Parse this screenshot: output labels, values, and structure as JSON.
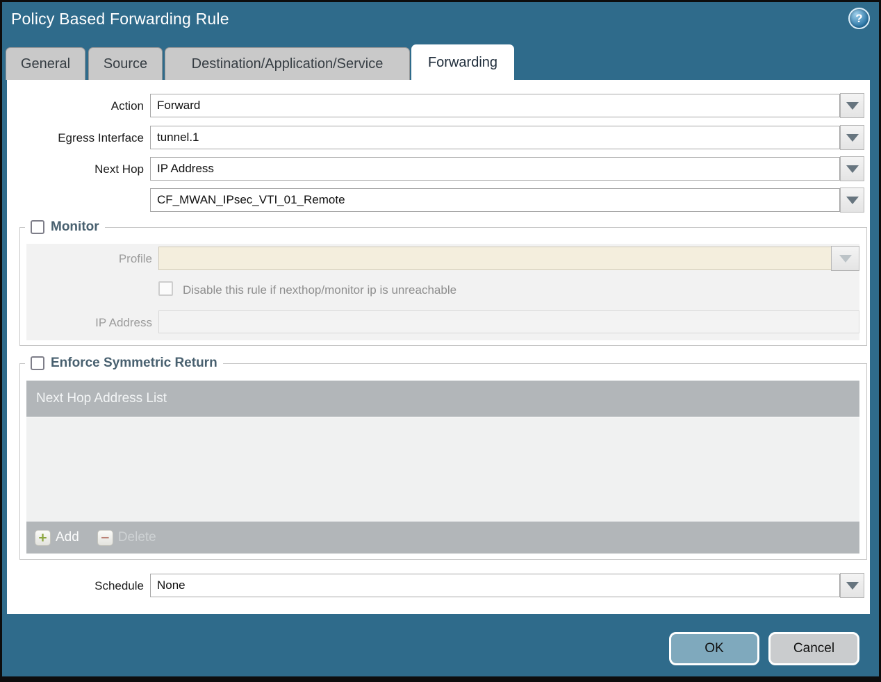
{
  "window": {
    "title": "Policy Based Forwarding Rule"
  },
  "help": {
    "glyph": "?"
  },
  "tabs": [
    {
      "label": "General",
      "active": false
    },
    {
      "label": "Source",
      "active": false
    },
    {
      "label": "Destination/Application/Service",
      "active": false
    },
    {
      "label": "Forwarding",
      "active": true
    }
  ],
  "form": {
    "action": {
      "label": "Action",
      "value": "Forward"
    },
    "egress_interface": {
      "label": "Egress Interface",
      "value": "tunnel.1"
    },
    "next_hop": {
      "label": "Next Hop",
      "value": "IP Address"
    },
    "next_hop_address": {
      "value": "CF_MWAN_IPsec_VTI_01_Remote"
    },
    "schedule": {
      "label": "Schedule",
      "value": "None"
    }
  },
  "monitor": {
    "label": "Monitor",
    "checked": false,
    "profile": {
      "label": "Profile",
      "value": ""
    },
    "disable_rule": {
      "label": "Disable this rule if nexthop/monitor ip is unreachable",
      "checked": false
    },
    "ip_address": {
      "label": "IP Address",
      "value": ""
    }
  },
  "symmetric_return": {
    "label": "Enforce Symmetric Return",
    "checked": false,
    "table": {
      "header": "Next Hop Address List",
      "rows": []
    },
    "add_label": "Add",
    "delete_label": "Delete",
    "add_glyph": "+",
    "delete_glyph": "−"
  },
  "footer": {
    "ok_label": "OK",
    "cancel_label": "Cancel"
  },
  "colors": {
    "titlebar_teal": "#2f6b8b",
    "ok_button": "#7fa9bd",
    "table_header_gray": "#b2b6b9",
    "profile_beige": "#f4eedd"
  }
}
